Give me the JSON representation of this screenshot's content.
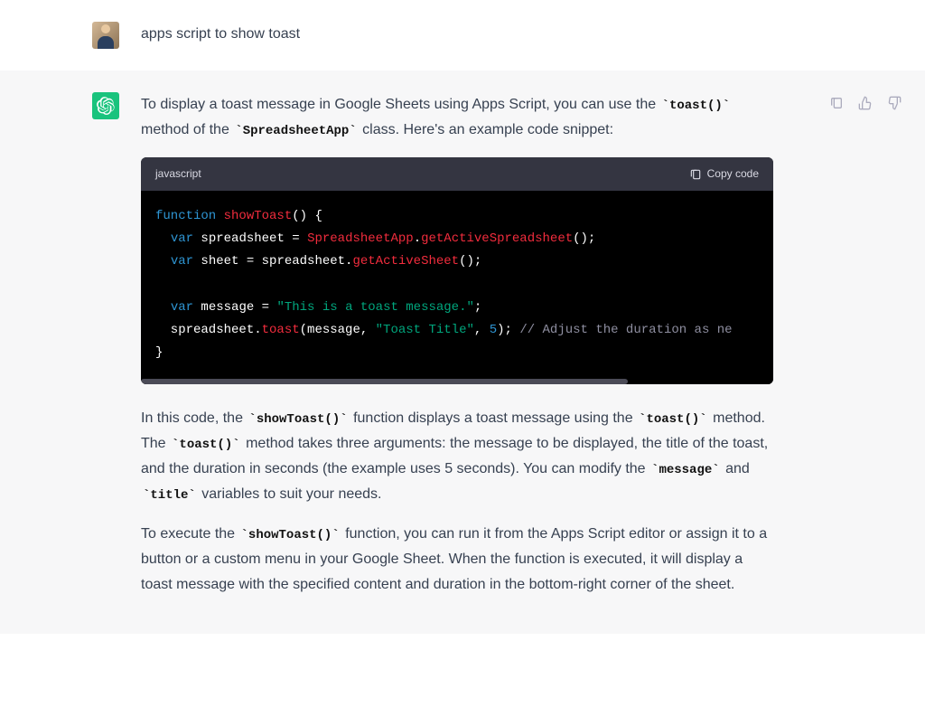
{
  "user": {
    "message": "apps script to show toast"
  },
  "assistant": {
    "intro_prefix": "To display a toast message in Google Sheets using Apps Script, you can use the ",
    "intro_code1": "toast()",
    "intro_mid": " method of the ",
    "intro_code2": "SpreadsheetApp",
    "intro_suffix": " class. Here's an example code snippet:",
    "code": {
      "language": "javascript",
      "copy_label": "Copy code",
      "tokens": {
        "kw_function": "function",
        "fn_name": "showToast",
        "paren_empty": "()",
        "brace_open": " {",
        "kw_var1": "var",
        "id_spreadsheet": " spreadsheet = ",
        "cls_spreadsheetapp": "SpreadsheetApp",
        "dot1": ".",
        "m_getactivess": "getActiveSpreadsheet",
        "call_end1": "();",
        "kw_var2": "var",
        "id_sheet": " sheet = spreadsheet.",
        "m_getactivesheet": "getActiveSheet",
        "call_end2": "();",
        "kw_var3": "var",
        "id_message": " message = ",
        "str_message": "\"This is a toast message.\"",
        "semi": ";",
        "call_toast_pre": "  spreadsheet.",
        "m_toast": "toast",
        "args_open": "(message, ",
        "str_title": "\"Toast Title\"",
        "args_mid": ", ",
        "num_5": "5",
        "args_close": "); ",
        "comment": "// Adjust the duration as ne",
        "brace_close": "}"
      }
    },
    "p2_a": "In this code, the ",
    "p2_code1": "showToast()",
    "p2_b": " function displays a toast message using the ",
    "p2_code2": "toast()",
    "p2_c": " method. The ",
    "p2_code3": "toast()",
    "p2_d": " method takes three arguments: the message to be displayed, the title of the toast, and the duration in seconds (the example uses 5 seconds). You can modify the ",
    "p2_code4": "message",
    "p2_e": " and ",
    "p2_code5": "title",
    "p2_f": " variables to suit your needs.",
    "p3_a": "To execute the ",
    "p3_code1": "showToast()",
    "p3_b": " function, you can run it from the Apps Script editor or assign it to a button or a custom menu in your Google Sheet. When the function is executed, it will display a toast message with the specified content and duration in the bottom-right corner of the sheet."
  }
}
